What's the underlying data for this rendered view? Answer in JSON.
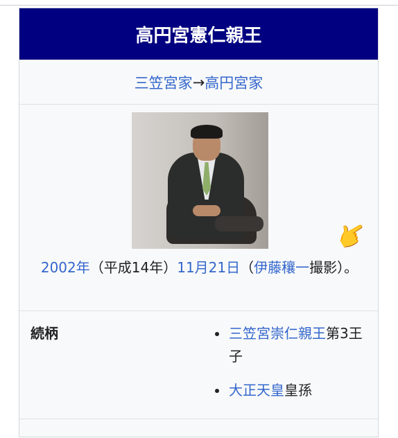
{
  "infobox": {
    "title": "高円宮憲仁親王",
    "house": {
      "from_link": "三笠宮家",
      "arrow": "→",
      "to_link": "高円宮家"
    },
    "photo_icon": "portrait-photo",
    "caption": {
      "year_link": "2002年",
      "era": "（平成14年）",
      "date_link": "11月21日",
      "open_paren": "（",
      "photographer_link": "伊藤穰一",
      "tail": "撮影）。"
    },
    "pointer_icon": "pointing-hand-emoji",
    "pointer_glyph": "👉",
    "relation": {
      "label": "続柄",
      "items": [
        {
          "link": "三笠宮崇仁親王",
          "text": "第3王子"
        },
        {
          "link": "大正天皇",
          "text": "皇孫"
        }
      ]
    }
  },
  "colors": {
    "title_bg": "#000080",
    "link": "#3366cc",
    "box_bg": "#f8f9fa"
  }
}
